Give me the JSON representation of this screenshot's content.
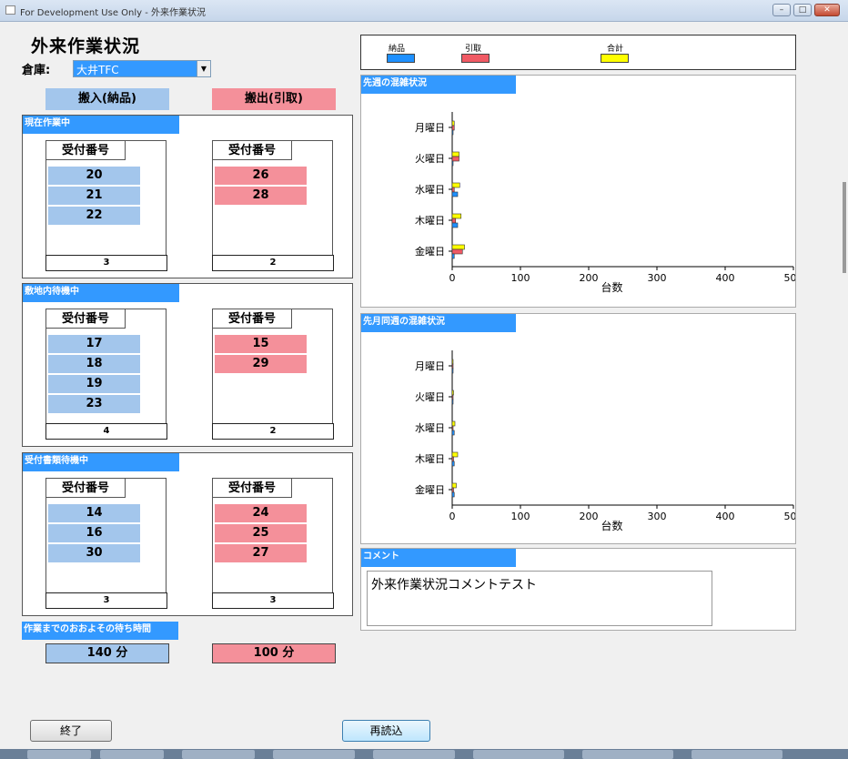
{
  "window": {
    "title": "For Development Use Only - 外来作業状況"
  },
  "page": {
    "title": "外来作業状況"
  },
  "warehouse": {
    "label": "倉庫:",
    "selected": "大井TFC"
  },
  "columns": {
    "in": "搬入(納品)",
    "out": "搬出(引取)"
  },
  "groups": [
    {
      "title": "現在作業中",
      "header": "受付番号",
      "in": [
        "20",
        "21",
        "22"
      ],
      "out": [
        "26",
        "28"
      ],
      "in_count": "3",
      "out_count": "2"
    },
    {
      "title": "敷地内待機中",
      "header": "受付番号",
      "in": [
        "17",
        "18",
        "19",
        "23"
      ],
      "out": [
        "15",
        "29"
      ],
      "in_count": "4",
      "out_count": "2"
    },
    {
      "title": "受付書類待機中",
      "header": "受付番号",
      "in": [
        "14",
        "16",
        "30"
      ],
      "out": [
        "24",
        "25",
        "27"
      ],
      "in_count": "3",
      "out_count": "3"
    }
  ],
  "wait": {
    "title": "作業までのおおよその待ち時間",
    "in": "140 分",
    "out": "100 分"
  },
  "legend": {
    "items": [
      {
        "label": "納品",
        "color": "#1e90ff"
      },
      {
        "label": "引取",
        "color": "#f05a64"
      },
      {
        "label": "合計",
        "color": "#ffff00"
      }
    ]
  },
  "chart_data": [
    {
      "type": "bar",
      "orientation": "horizontal",
      "title": "先週の混雑状況",
      "categories": [
        "月曜日",
        "火曜日",
        "水曜日",
        "木曜日",
        "金曜日"
      ],
      "xlabel": "台数",
      "xlim": [
        0,
        500
      ],
      "xticks": [
        0,
        100,
        200,
        300,
        400,
        500
      ],
      "series": [
        {
          "name": "納品",
          "values": [
            0,
            0,
            8,
            8,
            3
          ]
        },
        {
          "name": "引取",
          "values": [
            3,
            10,
            3,
            5,
            15
          ]
        },
        {
          "name": "合計",
          "values": [
            3,
            10,
            11,
            13,
            18
          ]
        }
      ]
    },
    {
      "type": "bar",
      "orientation": "horizontal",
      "title": "先月同週の混雑状況",
      "categories": [
        "月曜日",
        "火曜日",
        "水曜日",
        "木曜日",
        "金曜日"
      ],
      "xlabel": "台数",
      "xlim": [
        0,
        500
      ],
      "xticks": [
        0,
        100,
        200,
        300,
        400,
        500
      ],
      "series": [
        {
          "name": "納品",
          "values": [
            0,
            0,
            3,
            3,
            3
          ]
        },
        {
          "name": "引取",
          "values": [
            1,
            1,
            0,
            2,
            2
          ]
        },
        {
          "name": "合計",
          "values": [
            1,
            2,
            4,
            8,
            6
          ]
        }
      ]
    }
  ],
  "comment": {
    "title": "コメント",
    "text": "外来作業状況コメントテスト"
  },
  "buttons": {
    "exit": "終了",
    "reload": "再読込"
  },
  "window_controls": {
    "minimize": "–",
    "maximize": "□",
    "close": "✕"
  }
}
